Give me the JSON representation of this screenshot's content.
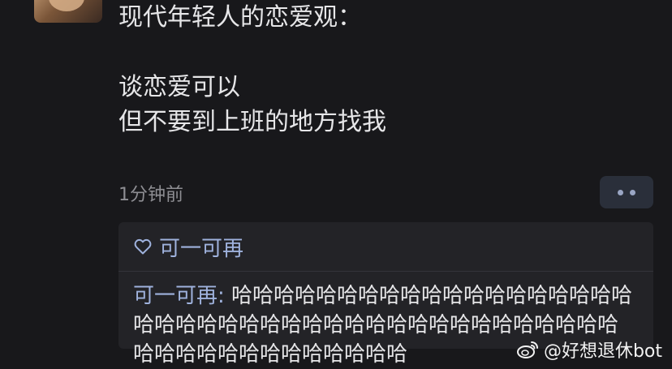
{
  "post": {
    "lines": [
      "现代年轻人的恋爱观：",
      "",
      "谈恋爱可以",
      "但不要到上班的地方找我"
    ],
    "timestamp": "1分钟前"
  },
  "likes": {
    "names": "可一可再"
  },
  "comment": {
    "author": "可一可再",
    "separator": ": ",
    "text": "哈哈哈哈哈哈哈哈哈哈哈哈哈哈哈哈哈哈哈哈哈哈哈哈哈哈哈哈哈哈哈哈哈哈哈哈哈哈哈哈哈哈哈哈哈哈哈哈哈哈哈哈哈哈哈"
  },
  "watermark": {
    "text": "@好想退休bot",
    "icon": "weibo-icon"
  },
  "colors": {
    "background": "#18181b",
    "accent": "#9fb2dd",
    "muted": "#8e8e93"
  }
}
